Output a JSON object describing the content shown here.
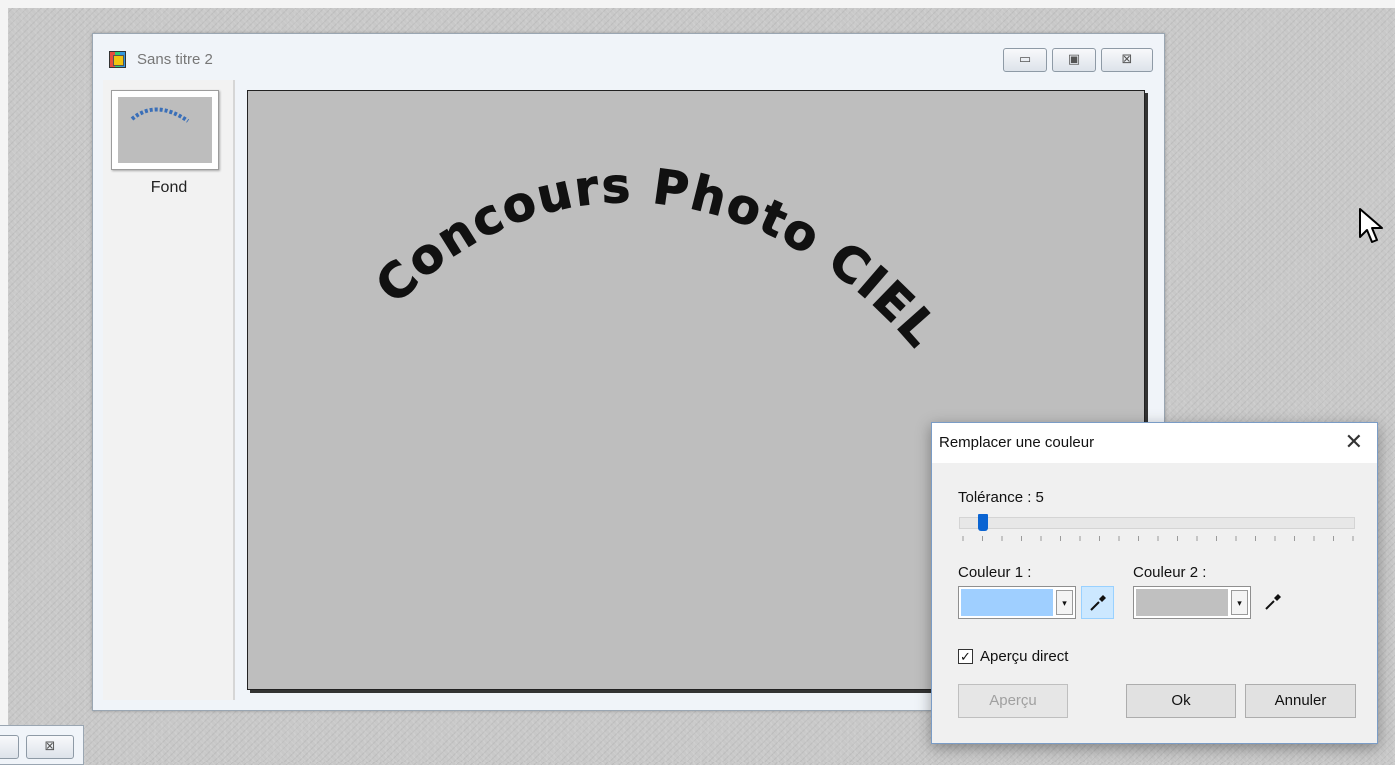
{
  "document_window": {
    "title": "Sans titre 2",
    "minimize_glyph": "▭",
    "maximize_glyph": "▣",
    "close_glyph": "⊠",
    "layers": [
      {
        "name": "Fond"
      }
    ],
    "canvas": {
      "text": "Concours Photo CIEL",
      "background_color": "#bebebe",
      "text_color": "#111111"
    }
  },
  "mini_window": {
    "close_glyph": "⊠"
  },
  "dialog": {
    "title": "Remplacer une couleur",
    "close_glyph": "✕",
    "tolerance_label": "Tolérance : 5",
    "tolerance_value": 5,
    "tolerance_max": 100,
    "color1_label": "Couleur 1 :",
    "color1_value": "#9fcfff",
    "color2_label": "Couleur 2 :",
    "color2_value": "#c0c0c0",
    "dropdown_glyph": "▾",
    "dropper_icon": "eyedropper-icon",
    "live_preview_label": "Aperçu direct",
    "live_preview_checked": true,
    "check_glyph": "✓",
    "preview_button": "Aperçu",
    "ok_button": "Ok",
    "cancel_button": "Annuler"
  }
}
